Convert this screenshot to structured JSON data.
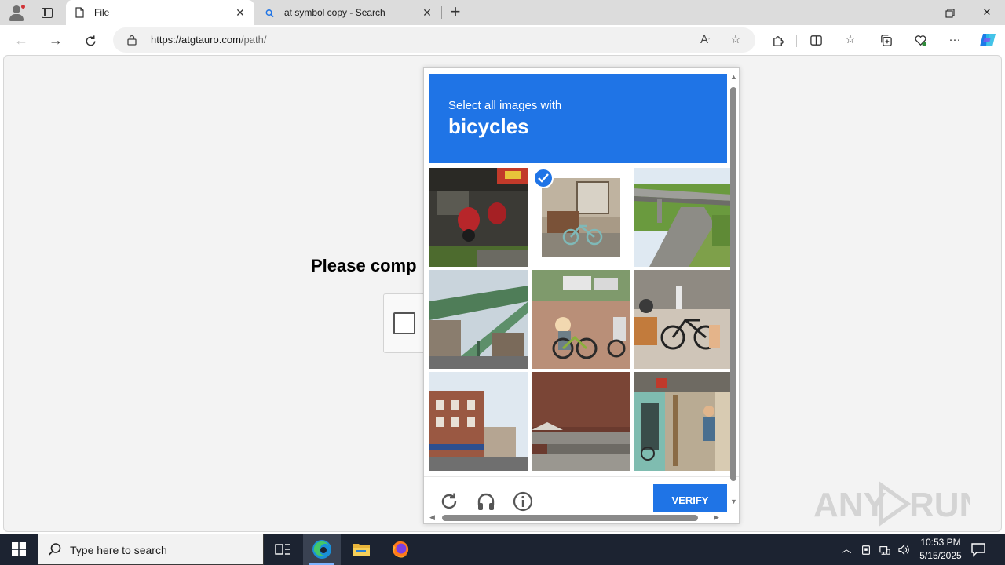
{
  "browser": {
    "tabs": [
      {
        "label": "File",
        "active": true
      },
      {
        "label": "at symbol copy - Search",
        "active": false
      }
    ],
    "address": {
      "host": "https://atgtauro.com",
      "path": "/path/"
    }
  },
  "page": {
    "heading_visible": "Please comp"
  },
  "captcha": {
    "prompt_small": "Select all images with",
    "prompt_big": "bicycles",
    "verify_label": "VERIFY",
    "selected_tiles": [
      2
    ]
  },
  "watermark": {
    "text": "ANY RUN"
  },
  "taskbar": {
    "search_placeholder": "Type here to search",
    "time": "10:53 PM",
    "date": "5/15/2025"
  },
  "colors": {
    "accent": "#1f74e6",
    "taskbar": "#1c2331"
  }
}
